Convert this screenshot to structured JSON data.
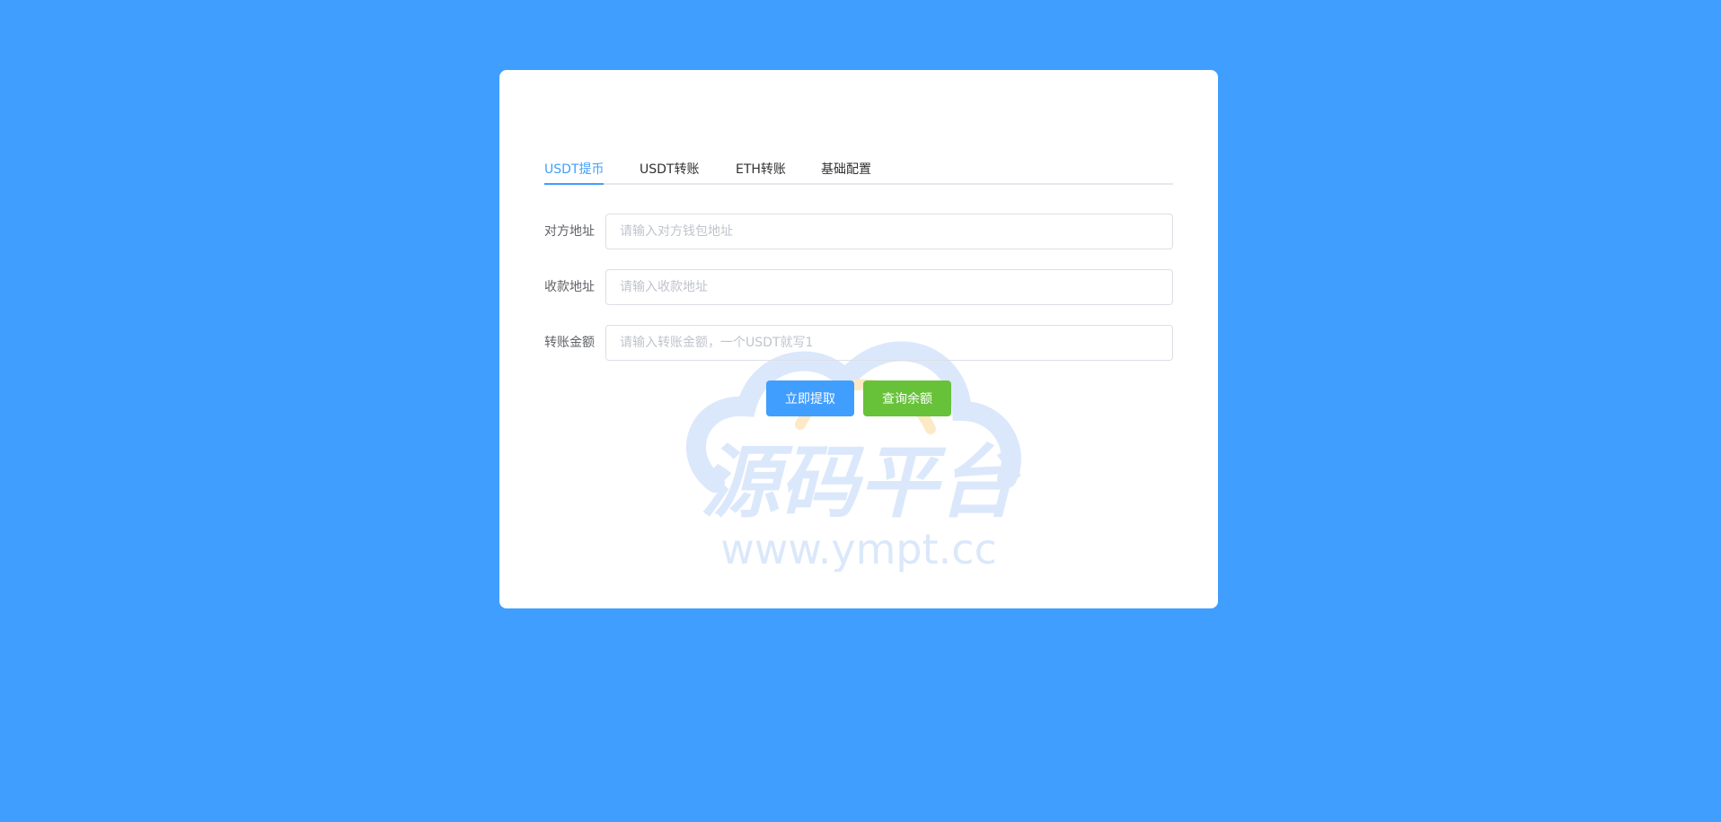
{
  "tabs": [
    {
      "label": "USDT提币",
      "active": true
    },
    {
      "label": "USDT转账",
      "active": false
    },
    {
      "label": "ETH转账",
      "active": false
    },
    {
      "label": "基础配置",
      "active": false
    }
  ],
  "form": {
    "counterparty_address": {
      "label": "对方地址",
      "placeholder": "请输入对方钱包地址",
      "value": ""
    },
    "receiving_address": {
      "label": "收款地址",
      "placeholder": "请输入收款地址",
      "value": ""
    },
    "transfer_amount": {
      "label": "转账金额",
      "placeholder": "请输入转账金额，一个USDT就写1",
      "value": ""
    }
  },
  "buttons": {
    "withdraw_label": "立即提取",
    "query_balance_label": "查询余额"
  },
  "watermark": {
    "title": "源码平台",
    "url": "www.ympt.cc"
  },
  "colors": {
    "background": "#409eff",
    "primary": "#409eff",
    "success": "#67c23a",
    "watermark_blue": "#dbe8fb",
    "watermark_orange": "#fde9c6"
  }
}
